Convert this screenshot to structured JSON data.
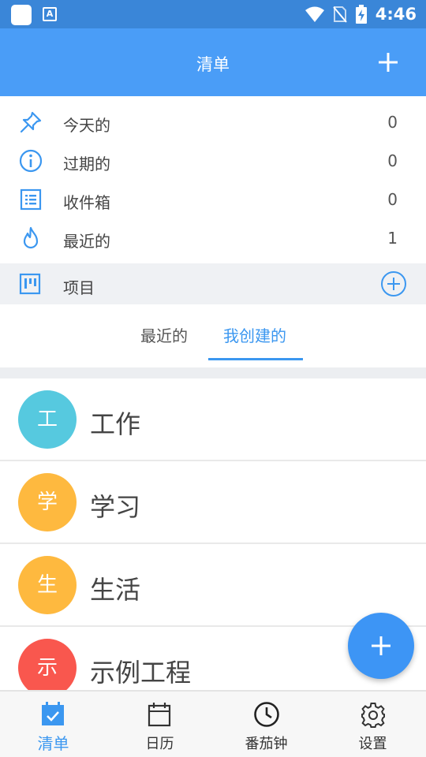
{
  "status_bar": {
    "time": "4:46"
  },
  "app_bar": {
    "title": "清单"
  },
  "menu": [
    {
      "label": "今天的",
      "count": "0",
      "icon": "pin-icon"
    },
    {
      "label": "过期的",
      "count": "0",
      "icon": "info-icon"
    },
    {
      "label": "收件箱",
      "count": "0",
      "icon": "inbox-list-icon"
    },
    {
      "label": "最近的",
      "count": "1",
      "icon": "flame-icon"
    }
  ],
  "projects_header": {
    "label": "项目"
  },
  "tabs": {
    "recent": "最近的",
    "mine": "我创建的",
    "active": "mine"
  },
  "projects": [
    {
      "initial": "工",
      "name": "工作",
      "color": "#56c9df"
    },
    {
      "initial": "学",
      "name": "学习",
      "color": "#feb93f"
    },
    {
      "initial": "生",
      "name": "生活",
      "color": "#feb93f"
    },
    {
      "initial": "示",
      "name": "示例工程",
      "color": "#f9574e"
    }
  ],
  "bottom_nav": [
    {
      "label": "清单",
      "icon": "checklist-icon",
      "active": true
    },
    {
      "label": "日历",
      "icon": "calendar-icon",
      "active": false
    },
    {
      "label": "番茄钟",
      "icon": "clock-icon",
      "active": false
    },
    {
      "label": "设置",
      "icon": "gear-icon",
      "active": false
    }
  ],
  "colors": {
    "app_bar": "#4a9df7",
    "status_bar": "#3a86d8",
    "accent": "#3b97f0"
  }
}
